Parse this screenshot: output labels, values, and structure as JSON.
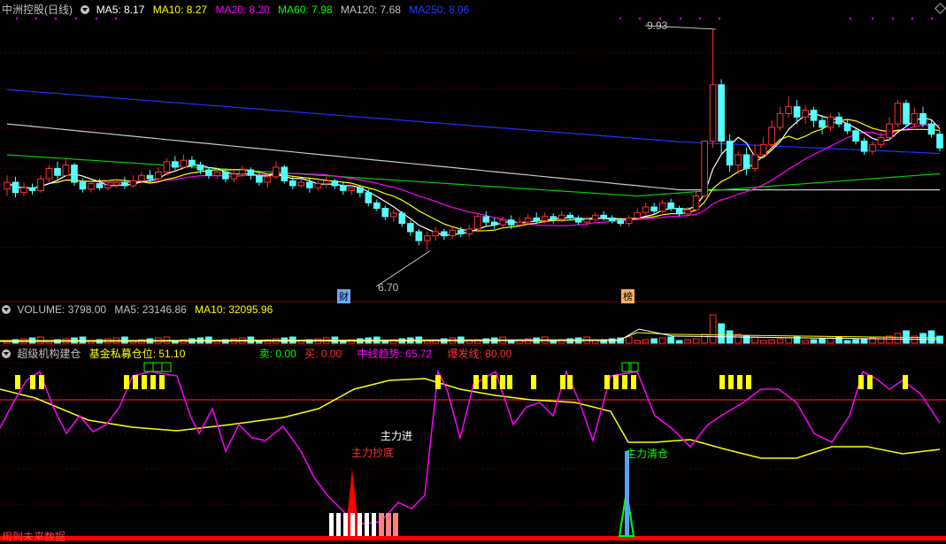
{
  "main_header": {
    "title": "中洲控股(日线)",
    "ma": [
      {
        "label": "MA5: 8.17",
        "color": "#ffffff"
      },
      {
        "label": "MA10: 8.27",
        "color": "#ffff00"
      },
      {
        "label": "MA20: 8.20",
        "color": "#ff00ff"
      },
      {
        "label": "MA60: 7.98",
        "color": "#00ff00"
      },
      {
        "label": "MA120: 7.68",
        "color": "#c0c0c0"
      },
      {
        "label": "MA250: 8.06",
        "color": "#0000ff"
      }
    ]
  },
  "volume_header": {
    "items": [
      {
        "label": "VOLUME: 3798.00",
        "color": "#c0c0c0"
      },
      {
        "label": "MA5: 23146.86",
        "color": "#c0c0c0"
      },
      {
        "label": "MA10: 32095.96",
        "color": "#ffff00"
      }
    ]
  },
  "indicator_header": {
    "items": [
      {
        "label": "超级机构建仓",
        "color": "#c0c0c0"
      },
      {
        "label": "基金私募仓位: 51.10",
        "color": "#ffff00"
      },
      {
        "label": "卖: 0.00",
        "color": "#00ff00"
      },
      {
        "label": "买: 0.00",
        "color": "#ff3030"
      },
      {
        "label": "中线趋势: 65.72",
        "color": "#ff00ff"
      },
      {
        "label": "爆发线: 80.00",
        "color": "#ff3030"
      }
    ]
  },
  "annotations": {
    "high_label": "9.93",
    "low_label": "6.70",
    "marker_cai": "财",
    "marker_bang": "榜",
    "zhuli_jin": "主力进",
    "zhuli_chaodi": "主力抄底",
    "zhuli_qingcang": "主力清仓",
    "footer": "用到未来数据"
  },
  "chart_data": {
    "type": "candlestick",
    "price_range": [
      6.0,
      10.2
    ],
    "high": 9.93,
    "low": 6.7,
    "candles": [
      [
        7.6,
        7.7,
        7.8,
        7.5
      ],
      [
        7.7,
        7.55,
        7.78,
        7.48
      ],
      [
        7.55,
        7.62,
        7.7,
        7.5
      ],
      [
        7.62,
        7.58,
        7.68,
        7.52
      ],
      [
        7.58,
        7.75,
        7.8,
        7.55
      ],
      [
        7.75,
        7.9,
        7.95,
        7.7
      ],
      [
        7.9,
        7.8,
        8.0,
        7.75
      ],
      [
        7.8,
        7.95,
        8.05,
        7.78
      ],
      [
        7.95,
        7.7,
        7.98,
        7.65
      ],
      [
        7.7,
        7.6,
        7.75,
        7.55
      ],
      [
        7.6,
        7.68,
        7.72,
        7.55
      ],
      [
        7.68,
        7.62,
        7.75,
        7.58
      ],
      [
        7.62,
        7.66,
        7.7,
        7.58
      ],
      [
        7.66,
        7.7,
        7.75,
        7.62
      ],
      [
        7.7,
        7.65,
        7.78,
        7.6
      ],
      [
        7.65,
        7.72,
        7.8,
        7.62
      ],
      [
        7.72,
        7.8,
        7.85,
        7.68
      ],
      [
        7.8,
        7.75,
        7.88,
        7.7
      ],
      [
        7.75,
        7.85,
        7.92,
        7.72
      ],
      [
        7.85,
        8.0,
        8.05,
        7.8
      ],
      [
        8.0,
        7.92,
        8.08,
        7.88
      ],
      [
        7.92,
        8.02,
        8.1,
        7.9
      ],
      [
        8.02,
        7.95,
        8.08,
        7.9
      ],
      [
        7.95,
        7.88,
        8.0,
        7.82
      ],
      [
        7.88,
        7.8,
        7.92,
        7.75
      ],
      [
        7.8,
        7.85,
        7.9,
        7.75
      ],
      [
        7.85,
        7.75,
        7.9,
        7.7
      ],
      [
        7.75,
        7.82,
        7.88,
        7.7
      ],
      [
        7.82,
        7.88,
        7.95,
        7.78
      ],
      [
        7.88,
        7.8,
        7.92,
        7.74
      ],
      [
        7.8,
        7.7,
        7.85,
        7.65
      ],
      [
        7.7,
        7.78,
        7.82,
        7.62
      ],
      [
        7.78,
        7.92,
        8.0,
        7.75
      ],
      [
        7.92,
        7.72,
        7.95,
        7.68
      ],
      [
        7.72,
        7.65,
        7.78,
        7.6
      ],
      [
        7.65,
        7.7,
        7.75,
        7.62
      ],
      [
        7.7,
        7.62,
        7.75,
        7.55
      ],
      [
        7.62,
        7.68,
        7.72,
        7.58
      ],
      [
        7.68,
        7.72,
        7.78,
        7.62
      ],
      [
        7.72,
        7.65,
        7.75,
        7.6
      ],
      [
        7.65,
        7.58,
        7.7,
        7.52
      ],
      [
        7.58,
        7.62,
        7.66,
        7.52
      ],
      [
        7.62,
        7.55,
        7.65,
        7.48
      ],
      [
        7.55,
        7.4,
        7.6,
        7.35
      ],
      [
        7.4,
        7.32,
        7.45,
        7.28
      ],
      [
        7.32,
        7.2,
        7.36,
        7.15
      ],
      [
        7.2,
        7.25,
        7.3,
        7.12
      ],
      [
        7.25,
        7.1,
        7.28,
        7.05
      ],
      [
        7.1,
        6.98,
        7.15,
        6.92
      ],
      [
        6.98,
        6.85,
        7.02,
        6.78
      ],
      [
        6.85,
        6.92,
        6.98,
        6.7
      ],
      [
        6.92,
        6.98,
        7.05,
        6.85
      ],
      [
        6.98,
        6.92,
        7.02,
        6.86
      ],
      [
        6.92,
        7.0,
        7.05,
        6.88
      ],
      [
        7.0,
        6.95,
        7.05,
        6.9
      ],
      [
        6.95,
        7.02,
        7.08,
        6.9
      ],
      [
        7.02,
        7.2,
        7.25,
        6.98
      ],
      [
        7.2,
        7.12,
        7.28,
        7.05
      ],
      [
        7.12,
        7.08,
        7.18,
        7.02
      ],
      [
        7.08,
        7.15,
        7.2,
        7.04
      ],
      [
        7.15,
        7.08,
        7.22,
        7.02
      ],
      [
        7.08,
        7.12,
        7.18,
        7.04
      ],
      [
        7.12,
        7.18,
        7.24,
        7.08
      ],
      [
        7.18,
        7.14,
        7.26,
        7.1
      ],
      [
        7.14,
        7.2,
        7.26,
        7.1
      ],
      [
        7.2,
        7.16,
        7.25,
        7.1
      ],
      [
        7.16,
        7.22,
        7.28,
        7.12
      ],
      [
        7.22,
        7.18,
        7.26,
        7.14
      ],
      [
        7.18,
        7.12,
        7.22,
        7.08
      ],
      [
        7.12,
        7.16,
        7.2,
        7.06
      ],
      [
        7.16,
        7.22,
        7.26,
        7.12
      ],
      [
        7.22,
        7.18,
        7.28,
        7.14
      ],
      [
        7.18,
        7.14,
        7.22,
        7.1
      ],
      [
        7.14,
        7.1,
        7.18,
        7.06
      ],
      [
        7.1,
        7.18,
        7.22,
        7.06
      ],
      [
        7.18,
        7.26,
        7.32,
        7.14
      ],
      [
        7.26,
        7.34,
        7.4,
        7.22
      ],
      [
        7.34,
        7.28,
        7.4,
        7.24
      ],
      [
        7.28,
        7.4,
        7.45,
        7.25
      ],
      [
        7.4,
        7.32,
        7.46,
        7.28
      ],
      [
        7.32,
        7.24,
        7.36,
        7.2
      ],
      [
        7.24,
        7.3,
        7.34,
        7.2
      ],
      [
        7.3,
        7.5,
        7.58,
        7.28
      ],
      [
        7.5,
        8.3,
        8.3,
        7.48
      ],
      [
        8.3,
        9.12,
        9.93,
        8.2
      ],
      [
        9.12,
        8.3,
        9.2,
        8.1
      ],
      [
        8.3,
        7.95,
        8.4,
        7.85
      ],
      [
        7.95,
        8.1,
        8.15,
        7.82
      ],
      [
        8.1,
        7.9,
        8.2,
        7.8
      ],
      [
        7.9,
        8.1,
        8.25,
        7.85
      ],
      [
        8.1,
        8.25,
        8.35,
        8.05
      ],
      [
        8.25,
        8.5,
        8.6,
        8.2
      ],
      [
        8.5,
        8.7,
        8.8,
        8.45
      ],
      [
        8.7,
        8.8,
        8.95,
        8.65
      ],
      [
        8.8,
        8.65,
        8.9,
        8.55
      ],
      [
        8.65,
        8.75,
        8.82,
        8.55
      ],
      [
        8.75,
        8.6,
        8.8,
        8.5
      ],
      [
        8.6,
        8.5,
        8.68,
        8.4
      ],
      [
        8.5,
        8.65,
        8.7,
        8.45
      ],
      [
        8.65,
        8.55,
        8.72,
        8.5
      ],
      [
        8.55,
        8.45,
        8.62,
        8.4
      ],
      [
        8.45,
        8.3,
        8.5,
        8.25
      ],
      [
        8.3,
        8.15,
        8.35,
        8.1
      ],
      [
        8.15,
        8.25,
        8.3,
        8.1
      ],
      [
        8.25,
        8.35,
        8.42,
        8.2
      ],
      [
        8.35,
        8.55,
        8.65,
        8.3
      ],
      [
        8.55,
        8.85,
        8.9,
        8.5
      ],
      [
        8.85,
        8.55,
        8.9,
        8.5
      ],
      [
        8.55,
        8.7,
        8.78,
        8.5
      ],
      [
        8.7,
        8.55,
        8.8,
        8.5
      ],
      [
        8.55,
        8.4,
        8.62,
        8.35
      ],
      [
        8.4,
        8.2,
        8.45,
        8.15
      ]
    ],
    "ma_series": [
      "MA5",
      "MA10",
      "MA20",
      "MA60",
      "MA120",
      "MA250"
    ]
  }
}
